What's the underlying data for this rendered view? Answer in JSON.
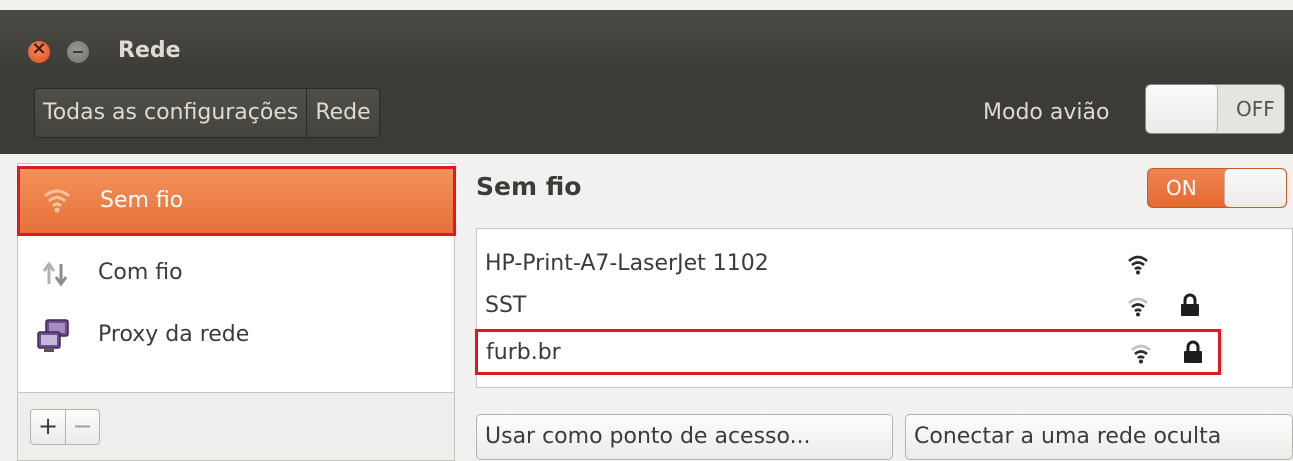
{
  "window": {
    "title": "Rede"
  },
  "toolbar": {
    "breadcrumbs": [
      "Todas as configurações",
      "Rede"
    ],
    "airplane_label": "Modo avião",
    "airplane_state": "OFF"
  },
  "sidebar": {
    "items": [
      {
        "label": "Sem fio",
        "icon": "wifi-icon",
        "selected": true
      },
      {
        "label": "Com fio",
        "icon": "wired-arrows-icon",
        "selected": false
      },
      {
        "label": "Proxy da rede",
        "icon": "proxy-computers-icon",
        "selected": false
      }
    ],
    "add_label": "+",
    "remove_label": "−"
  },
  "main": {
    "title": "Sem fio",
    "wifi_state": "ON",
    "networks": [
      {
        "name": "HP-Print-A7-LaserJet 1102",
        "locked": false,
        "signal": "full"
      },
      {
        "name": "SST",
        "locked": true,
        "signal": "medium"
      },
      {
        "name": "furb.br",
        "locked": true,
        "signal": "medium"
      }
    ],
    "hotspot_button": "Usar como ponto de acesso...",
    "hidden_button": "Conectar a uma rede oculta"
  },
  "colors": {
    "accent": "#e6713a",
    "highlight": "#e0191e",
    "titlebar": "#3c3b37"
  }
}
